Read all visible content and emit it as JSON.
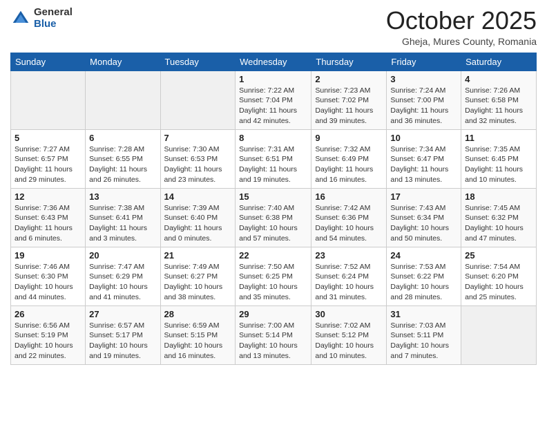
{
  "header": {
    "logo": {
      "general": "General",
      "blue": "Blue"
    },
    "title": "October 2025",
    "location": "Gheja, Mures County, Romania"
  },
  "weekdays": [
    "Sunday",
    "Monday",
    "Tuesday",
    "Wednesday",
    "Thursday",
    "Friday",
    "Saturday"
  ],
  "weeks": [
    [
      {
        "day": "",
        "info": ""
      },
      {
        "day": "",
        "info": ""
      },
      {
        "day": "",
        "info": ""
      },
      {
        "day": "1",
        "info": "Sunrise: 7:22 AM\nSunset: 7:04 PM\nDaylight: 11 hours and 42 minutes."
      },
      {
        "day": "2",
        "info": "Sunrise: 7:23 AM\nSunset: 7:02 PM\nDaylight: 11 hours and 39 minutes."
      },
      {
        "day": "3",
        "info": "Sunrise: 7:24 AM\nSunset: 7:00 PM\nDaylight: 11 hours and 36 minutes."
      },
      {
        "day": "4",
        "info": "Sunrise: 7:26 AM\nSunset: 6:58 PM\nDaylight: 11 hours and 32 minutes."
      }
    ],
    [
      {
        "day": "5",
        "info": "Sunrise: 7:27 AM\nSunset: 6:57 PM\nDaylight: 11 hours and 29 minutes."
      },
      {
        "day": "6",
        "info": "Sunrise: 7:28 AM\nSunset: 6:55 PM\nDaylight: 11 hours and 26 minutes."
      },
      {
        "day": "7",
        "info": "Sunrise: 7:30 AM\nSunset: 6:53 PM\nDaylight: 11 hours and 23 minutes."
      },
      {
        "day": "8",
        "info": "Sunrise: 7:31 AM\nSunset: 6:51 PM\nDaylight: 11 hours and 19 minutes."
      },
      {
        "day": "9",
        "info": "Sunrise: 7:32 AM\nSunset: 6:49 PM\nDaylight: 11 hours and 16 minutes."
      },
      {
        "day": "10",
        "info": "Sunrise: 7:34 AM\nSunset: 6:47 PM\nDaylight: 11 hours and 13 minutes."
      },
      {
        "day": "11",
        "info": "Sunrise: 7:35 AM\nSunset: 6:45 PM\nDaylight: 11 hours and 10 minutes."
      }
    ],
    [
      {
        "day": "12",
        "info": "Sunrise: 7:36 AM\nSunset: 6:43 PM\nDaylight: 11 hours and 6 minutes."
      },
      {
        "day": "13",
        "info": "Sunrise: 7:38 AM\nSunset: 6:41 PM\nDaylight: 11 hours and 3 minutes."
      },
      {
        "day": "14",
        "info": "Sunrise: 7:39 AM\nSunset: 6:40 PM\nDaylight: 11 hours and 0 minutes."
      },
      {
        "day": "15",
        "info": "Sunrise: 7:40 AM\nSunset: 6:38 PM\nDaylight: 10 hours and 57 minutes."
      },
      {
        "day": "16",
        "info": "Sunrise: 7:42 AM\nSunset: 6:36 PM\nDaylight: 10 hours and 54 minutes."
      },
      {
        "day": "17",
        "info": "Sunrise: 7:43 AM\nSunset: 6:34 PM\nDaylight: 10 hours and 50 minutes."
      },
      {
        "day": "18",
        "info": "Sunrise: 7:45 AM\nSunset: 6:32 PM\nDaylight: 10 hours and 47 minutes."
      }
    ],
    [
      {
        "day": "19",
        "info": "Sunrise: 7:46 AM\nSunset: 6:30 PM\nDaylight: 10 hours and 44 minutes."
      },
      {
        "day": "20",
        "info": "Sunrise: 7:47 AM\nSunset: 6:29 PM\nDaylight: 10 hours and 41 minutes."
      },
      {
        "day": "21",
        "info": "Sunrise: 7:49 AM\nSunset: 6:27 PM\nDaylight: 10 hours and 38 minutes."
      },
      {
        "day": "22",
        "info": "Sunrise: 7:50 AM\nSunset: 6:25 PM\nDaylight: 10 hours and 35 minutes."
      },
      {
        "day": "23",
        "info": "Sunrise: 7:52 AM\nSunset: 6:24 PM\nDaylight: 10 hours and 31 minutes."
      },
      {
        "day": "24",
        "info": "Sunrise: 7:53 AM\nSunset: 6:22 PM\nDaylight: 10 hours and 28 minutes."
      },
      {
        "day": "25",
        "info": "Sunrise: 7:54 AM\nSunset: 6:20 PM\nDaylight: 10 hours and 25 minutes."
      }
    ],
    [
      {
        "day": "26",
        "info": "Sunrise: 6:56 AM\nSunset: 5:19 PM\nDaylight: 10 hours and 22 minutes."
      },
      {
        "day": "27",
        "info": "Sunrise: 6:57 AM\nSunset: 5:17 PM\nDaylight: 10 hours and 19 minutes."
      },
      {
        "day": "28",
        "info": "Sunrise: 6:59 AM\nSunset: 5:15 PM\nDaylight: 10 hours and 16 minutes."
      },
      {
        "day": "29",
        "info": "Sunrise: 7:00 AM\nSunset: 5:14 PM\nDaylight: 10 hours and 13 minutes."
      },
      {
        "day": "30",
        "info": "Sunrise: 7:02 AM\nSunset: 5:12 PM\nDaylight: 10 hours and 10 minutes."
      },
      {
        "day": "31",
        "info": "Sunrise: 7:03 AM\nSunset: 5:11 PM\nDaylight: 10 hours and 7 minutes."
      },
      {
        "day": "",
        "info": ""
      }
    ]
  ]
}
